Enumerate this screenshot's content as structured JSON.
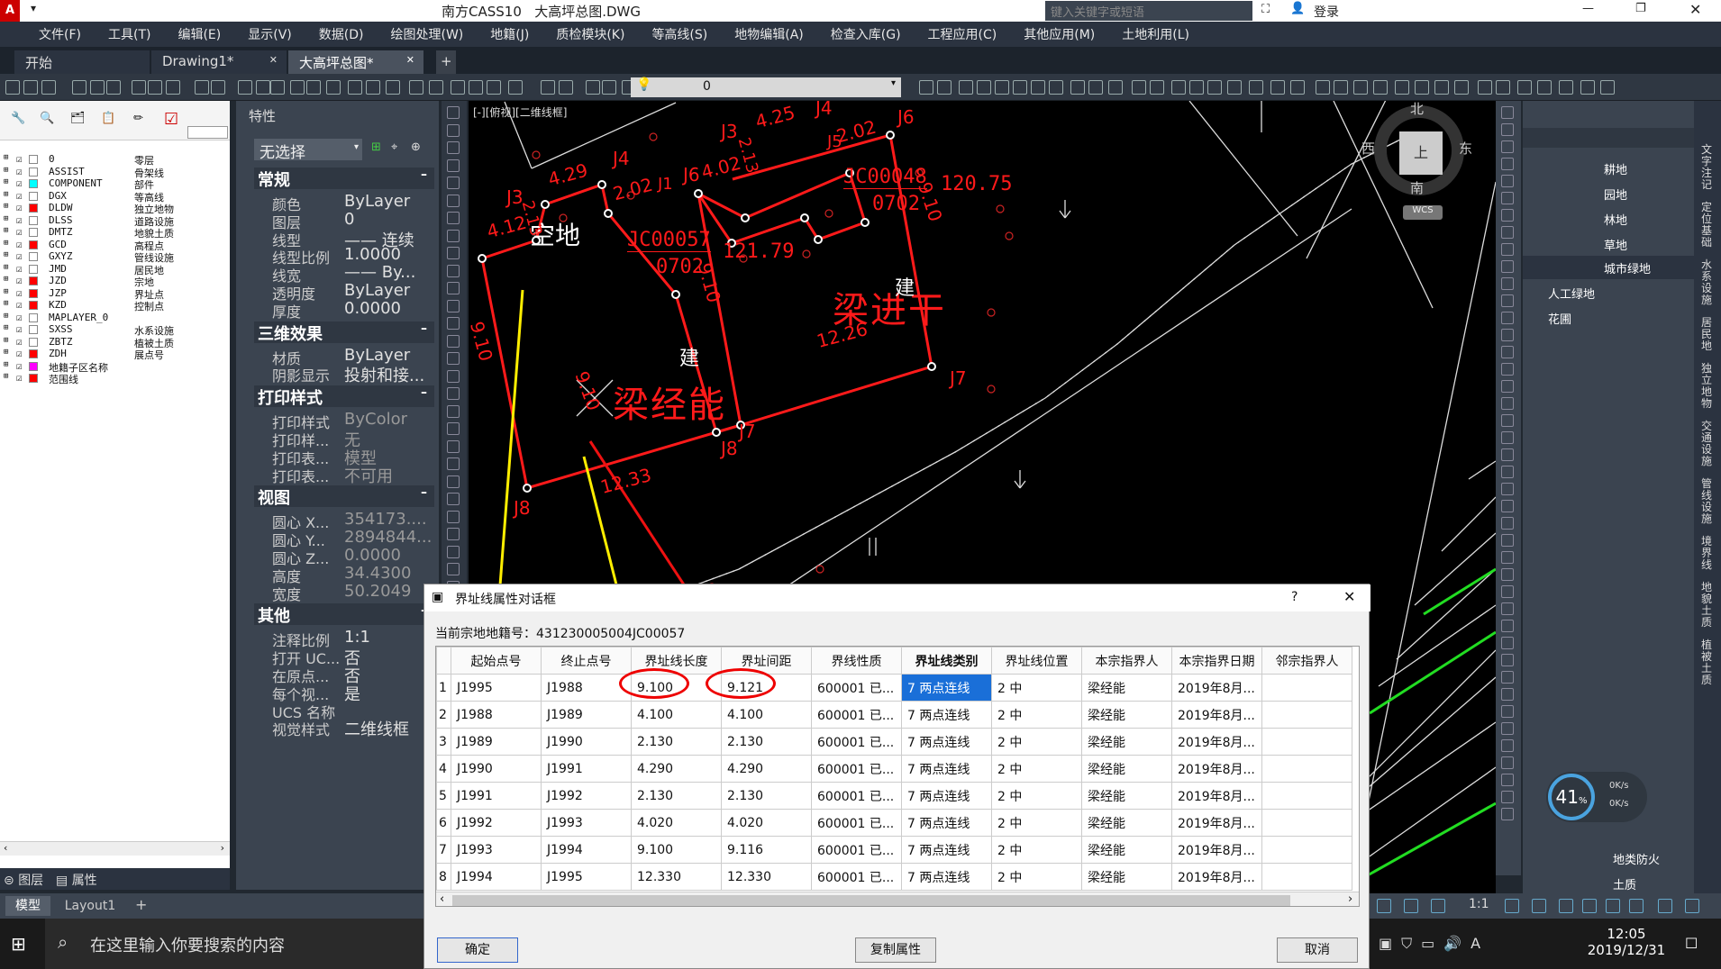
{
  "title": {
    "app": "南方CASS10",
    "file": "大高坪总图.DWG",
    "search_placeholder": "键入关键字或短语",
    "login": "登录"
  },
  "menu": [
    "文件(F)",
    "工具(T)",
    "编辑(E)",
    "显示(V)",
    "数据(D)",
    "绘图处理(W)",
    "地籍(J)",
    "质检模块(K)",
    "等高线(S)",
    "地物编辑(A)",
    "检查入库(G)",
    "工程应用(C)",
    "其他应用(M)",
    "土地利用(L)"
  ],
  "tabs": [
    "开始",
    "Drawing1*",
    "大高坪总图*"
  ],
  "layer_dropdown": "0",
  "layers": [
    {
      "name": "0",
      "desc": "零层",
      "color": "#ffffff"
    },
    {
      "name": "ASSIST",
      "desc": "骨架线",
      "color": "#ffffff"
    },
    {
      "name": "COMPONENT",
      "desc": "部件",
      "color": "#00ffff"
    },
    {
      "name": "DGX",
      "desc": "等高线",
      "color": "#ffffff"
    },
    {
      "name": "DLDW",
      "desc": "独立地物",
      "color": "#ff0000"
    },
    {
      "name": "DLSS",
      "desc": "道路设施",
      "color": "#ffffff"
    },
    {
      "name": "DMTZ",
      "desc": "地貌土质",
      "color": "#ffffff"
    },
    {
      "name": "GCD",
      "desc": "高程点",
      "color": "#ff0000"
    },
    {
      "name": "GXYZ",
      "desc": "管线设施",
      "color": "#ffffff"
    },
    {
      "name": "JMD",
      "desc": "居民地",
      "color": "#ffffff"
    },
    {
      "name": "JZD",
      "desc": "宗地",
      "color": "#ff0000"
    },
    {
      "name": "JZP",
      "desc": "界址点",
      "color": "#ff0000"
    },
    {
      "name": "KZD",
      "desc": "控制点",
      "color": "#ff0000"
    },
    {
      "name": "MAPLAYER_0",
      "desc": "",
      "color": "#ffffff"
    },
    {
      "name": "SXSS",
      "desc": "水系设施",
      "color": "#ffffff"
    },
    {
      "name": "ZBTZ",
      "desc": "植被土质",
      "color": "#ffffff"
    },
    {
      "name": "ZDH",
      "desc": "展点号",
      "color": "#ff0000"
    },
    {
      "name": "地籍子区名称",
      "desc": "",
      "color": "#ff00ff"
    },
    {
      "name": "范围线",
      "desc": "",
      "color": "#ff0000"
    }
  ],
  "layer_tabs": {
    "layers": "图层",
    "props": "属性"
  },
  "props": {
    "header": "特性",
    "selection": "无选择",
    "sections": [
      {
        "title": "常规",
        "rows": [
          [
            "颜色",
            "ByLayer"
          ],
          [
            "图层",
            "0"
          ],
          [
            "线型",
            "—— 连续"
          ],
          [
            "线型比例",
            "1.0000"
          ],
          [
            "线宽",
            "—— By..."
          ],
          [
            "透明度",
            "ByLayer"
          ],
          [
            "厚度",
            "0.0000"
          ]
        ]
      },
      {
        "title": "三维效果",
        "rows": [
          [
            "材质",
            "ByLayer"
          ],
          [
            "阴影显示",
            "投射和接..."
          ]
        ]
      },
      {
        "title": "打印样式",
        "rows": [
          [
            "打印样式",
            "ByColor"
          ],
          [
            "打印样...",
            "无"
          ],
          [
            "打印表...",
            "模型"
          ],
          [
            "打印表...",
            "不可用"
          ]
        ]
      },
      {
        "title": "视图",
        "rows": [
          [
            "圆心 X...",
            "354173...."
          ],
          [
            "圆心 Y...",
            "2894844..."
          ],
          [
            "圆心 Z...",
            "0.0000"
          ],
          [
            "高度",
            "34.4300"
          ],
          [
            "宽度",
            "50.2049"
          ]
        ]
      },
      {
        "title": "其他",
        "rows": [
          [
            "注释比例",
            "1:1"
          ],
          [
            "打开 UC...",
            "否"
          ],
          [
            "在原点...",
            "否"
          ],
          [
            "每个视...",
            "是"
          ],
          [
            "UCS 名称",
            ""
          ],
          [
            "视觉样式",
            "二维线框"
          ]
        ]
      }
    ]
  },
  "cad": {
    "view_label": "[-][俯视][二维线框]",
    "compass": {
      "n": "北",
      "s": "南",
      "e": "东",
      "w": "西",
      "center": "上",
      "wcs": "WCS"
    },
    "texts": {
      "empty_land": "空地",
      "owner1": "梁经能",
      "owner2": "梁进干",
      "build1": "建",
      "build2": "建",
      "code1": "JC00057",
      "code1b": "0702",
      "code2": "JC00048",
      "code2b": "0702",
      "area1": "121.79",
      "area2": "120.75"
    },
    "dims": [
      "9.10",
      "4.12",
      "2.13",
      "4.29",
      "2.02",
      "4.02",
      "2.13",
      "4.25",
      "2.02",
      "9.10",
      "12.26",
      "12.33",
      "9.10",
      "9.10"
    ],
    "points": [
      "J1",
      "J3",
      "J4",
      "J6",
      "J8",
      "J3",
      "J4",
      "J6",
      "J7",
      "J8",
      "J7",
      "J1",
      "J5"
    ]
  },
  "right_panel": {
    "items": [
      "耕地",
      "园地",
      "林地",
      "草地",
      "城市绿地",
      "人工绿地",
      "花圃",
      "地类防火",
      "土质"
    ],
    "vertical": [
      "文字注记",
      "定位基础",
      "水系设施",
      "居民地",
      "独立地物",
      "交通设施",
      "管线设施",
      "境界线",
      "地貌土质",
      "植被土质"
    ],
    "gauge": {
      "percent": "41",
      "unit": "%",
      "up": "0K/s",
      "down": "0K/s"
    }
  },
  "status": {
    "model": "模型",
    "layout": "Layout1",
    "scale": "1:1"
  },
  "taskbar": {
    "search": "在这里输入你要搜索的内容",
    "time": "12:05",
    "date": "2019/12/31"
  },
  "dialog": {
    "title": "界址线属性对话框",
    "parcel_label": "当前宗地地籍号：",
    "parcel_no": "431230005004JC00057",
    "columns": [
      "",
      "起始点号",
      "终止点号",
      "界址线长度",
      "界址间距",
      "界线性质",
      "界址线类别",
      "界址线位置",
      "本宗指界人",
      "本宗指界日期",
      "邻宗指界人"
    ],
    "rows": [
      [
        "1",
        "J1995",
        "J1988",
        "9.100",
        "9.121",
        "600001 已...",
        "7 两点连线",
        "2 中",
        "梁经能",
        "2019年8月..."
      ],
      [
        "2",
        "J1988",
        "J1989",
        "4.100",
        "4.100",
        "600001 已...",
        "7 两点连线",
        "2 中",
        "梁经能",
        "2019年8月..."
      ],
      [
        "3",
        "J1989",
        "J1990",
        "2.130",
        "2.130",
        "600001 已...",
        "7 两点连线",
        "2 中",
        "梁经能",
        "2019年8月..."
      ],
      [
        "4",
        "J1990",
        "J1991",
        "4.290",
        "4.290",
        "600001 已...",
        "7 两点连线",
        "2 中",
        "梁经能",
        "2019年8月..."
      ],
      [
        "5",
        "J1991",
        "J1992",
        "2.130",
        "2.130",
        "600001 已...",
        "7 两点连线",
        "2 中",
        "梁经能",
        "2019年8月..."
      ],
      [
        "6",
        "J1992",
        "J1993",
        "4.020",
        "4.020",
        "600001 已...",
        "7 两点连线",
        "2 中",
        "梁经能",
        "2019年8月..."
      ],
      [
        "7",
        "J1993",
        "J1994",
        "9.100",
        "9.116",
        "600001 已...",
        "7 两点连线",
        "2 中",
        "梁经能",
        "2019年8月..."
      ],
      [
        "8",
        "J1994",
        "J1995",
        "12.330",
        "12.330",
        "600001 已...",
        "7 两点连线",
        "2 中",
        "梁经能",
        "2019年8月..."
      ]
    ],
    "buttons": {
      "ok": "确定",
      "copy": "复制属性",
      "cancel": "取消"
    }
  }
}
